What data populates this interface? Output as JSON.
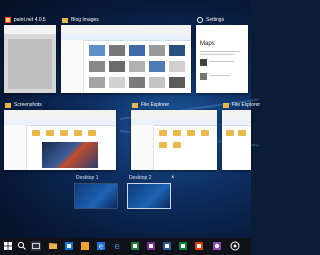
{
  "windows": [
    {
      "title": "paint.net 4.0.5",
      "icon": "paintnet-icon"
    },
    {
      "title": "Blog Images",
      "icon": "folder-icon"
    },
    {
      "title": "Settings",
      "icon": "gear-icon"
    },
    {
      "title": "Screenshots",
      "icon": "folder-icon"
    },
    {
      "title": "File Explorer",
      "icon": "folder-icon"
    },
    {
      "title": "File Explorer",
      "icon": "folder-icon"
    }
  ],
  "settings_window": {
    "heading": "Maps"
  },
  "desktops": [
    {
      "label": "Desktop 1"
    },
    {
      "label": "Desktop 2"
    }
  ],
  "close_glyph": "×",
  "taskbar": {
    "icons": [
      "windows-logo-icon",
      "search-icon",
      "task-view-icon",
      "file-explorer-icon",
      "store-icon",
      "folder-icon",
      "edge-icon",
      "edge-icon",
      "excel-icon",
      "onenote-icon",
      "word-icon",
      "settings-icon",
      "media-icon"
    ]
  },
  "colors": {
    "accent": "#0078d7",
    "taskbar": "#101217",
    "folder": "#e8b84a"
  }
}
